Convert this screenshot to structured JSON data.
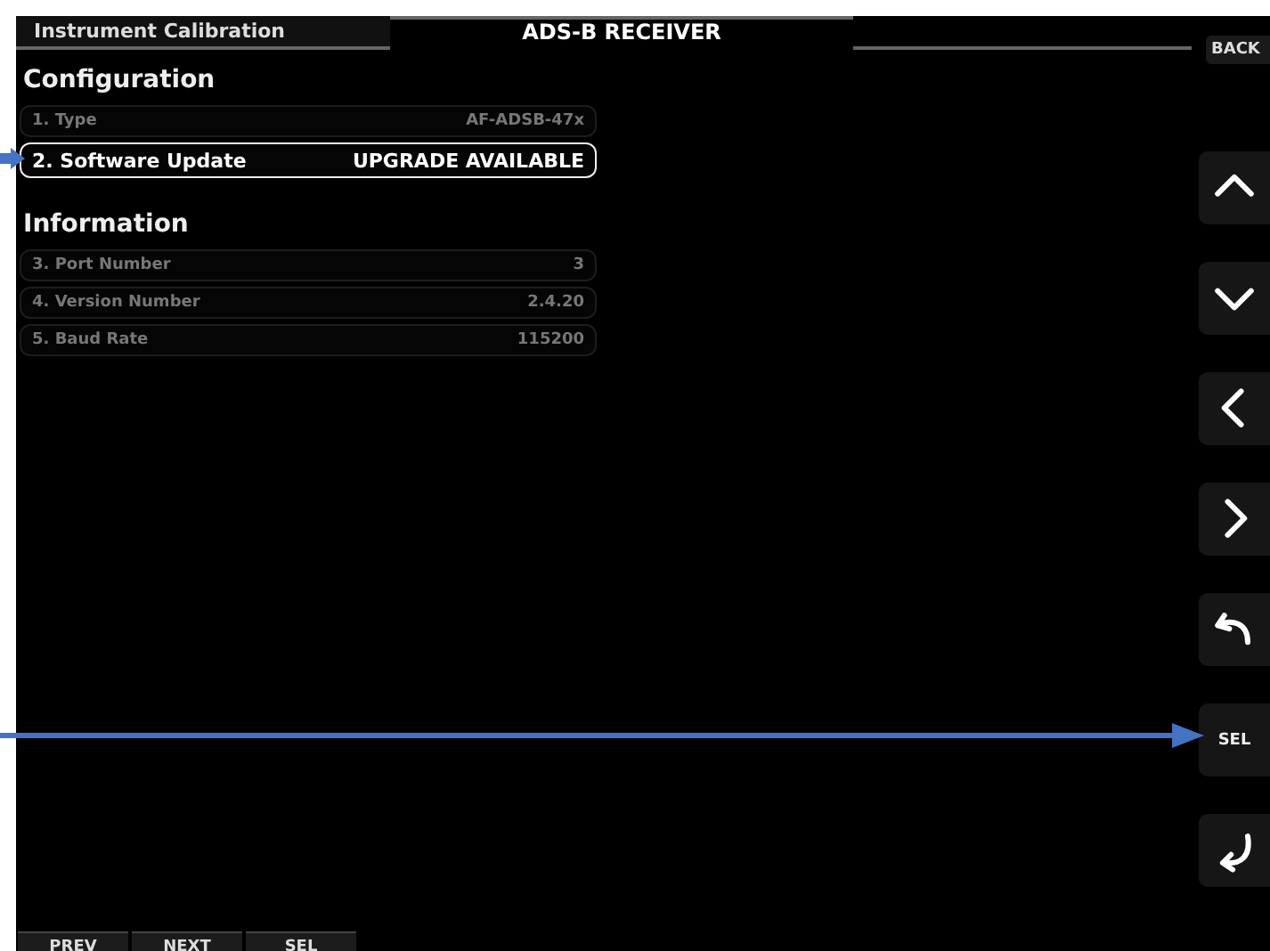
{
  "header": {
    "tab": "Instrument Calibration",
    "title": "ADS-B RECEIVER",
    "back": "BACK"
  },
  "sections": [
    {
      "heading": "Configuration",
      "rows": [
        {
          "label": "1. Type",
          "value": "AF-ADSB-47x",
          "selected": false
        },
        {
          "label": "2. Software Update",
          "value": "UPGRADE AVAILABLE",
          "selected": true
        }
      ]
    },
    {
      "heading": "Information",
      "rows": [
        {
          "label": "3. Port Number",
          "value": "3",
          "selected": false
        },
        {
          "label": "4. Version Number",
          "value": "2.4.20",
          "selected": false
        },
        {
          "label": "5. Baud Rate",
          "value": "115200",
          "selected": false
        }
      ]
    }
  ],
  "nav_buttons": [
    {
      "kind": "up"
    },
    {
      "kind": "down"
    },
    {
      "kind": "left"
    },
    {
      "kind": "right"
    },
    {
      "kind": "undo"
    },
    {
      "kind": "text",
      "label": "SEL"
    },
    {
      "kind": "enter"
    }
  ],
  "soft_keys": [
    "PREV",
    "NEXT",
    "SEL"
  ]
}
